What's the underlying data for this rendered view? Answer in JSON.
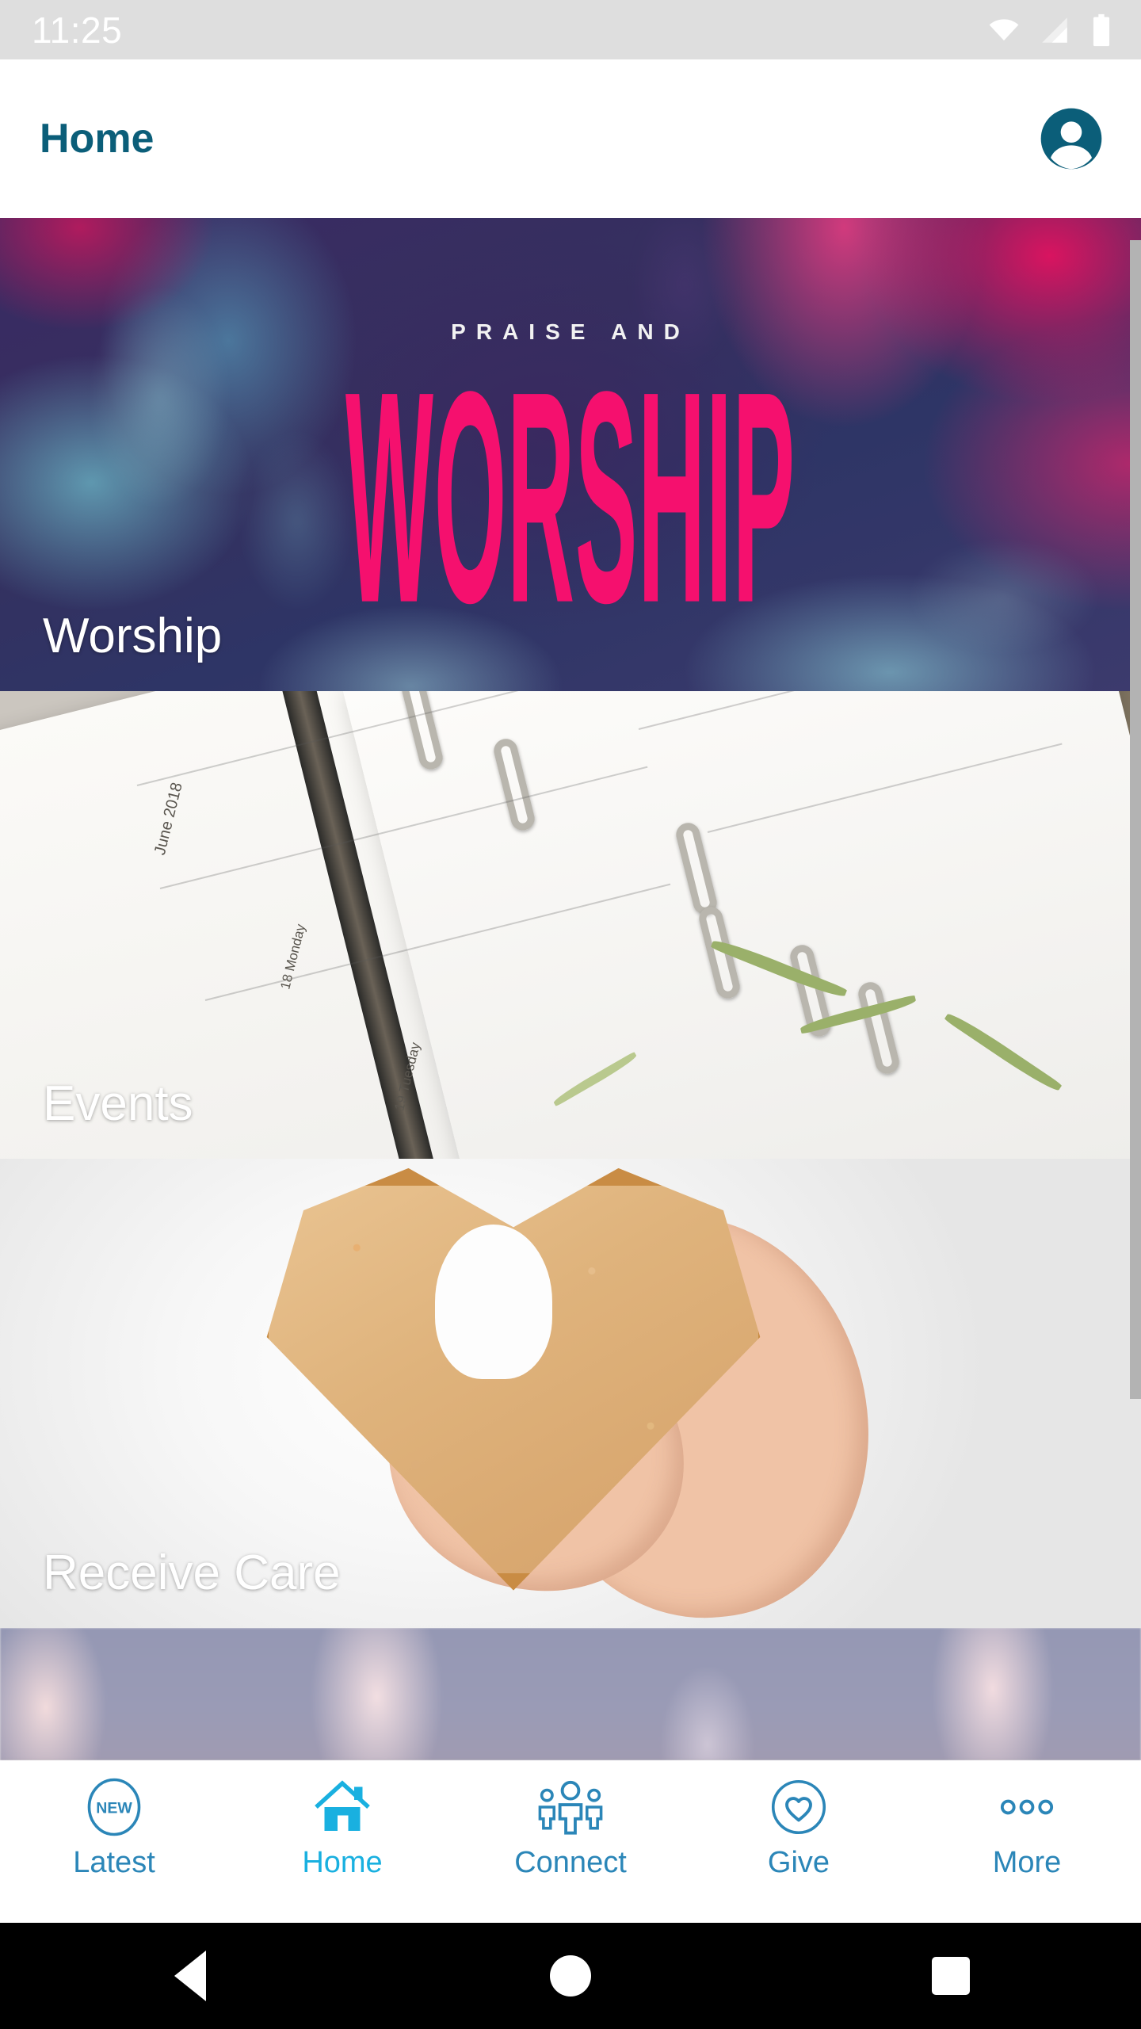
{
  "status_bar": {
    "clock": "11:25",
    "icons": [
      "wifi-icon",
      "cellular-signal-icon",
      "battery-icon"
    ],
    "background": "#dedede",
    "text_color": "#ffffff"
  },
  "app_bar": {
    "title": "Home",
    "title_color": "#0b5e79",
    "avatar_icon": "account-avatar-icon",
    "avatar_color": "#0b5e79"
  },
  "feed": {
    "cards": [
      {
        "label": "Worship",
        "artwork_overline": "PRAISE AND",
        "artwork_word": "WORSHIP",
        "artwork_word_color": "#f5106e",
        "image_description": "pink and teal smoke ink artwork"
      },
      {
        "label": "Events",
        "image_description": "open ring-bound planner with June 2018 page and plant sprigs on desk"
      },
      {
        "label": "Receive Care",
        "image_description": "hands holding a heart-shaped slice of bread"
      },
      {
        "label": "",
        "image_description": "pale lavender and pink bokeh lights"
      }
    ]
  },
  "scrollbar": {
    "visible": true,
    "color": "#b3b3b3"
  },
  "tab_bar": {
    "active_index": 1,
    "inactive_color": "#2b86b8",
    "active_color": "#19b0e0",
    "tabs": [
      {
        "label": "Latest",
        "icon": "new-badge-circle-icon"
      },
      {
        "label": "Home",
        "icon": "home-house-icon"
      },
      {
        "label": "Connect",
        "icon": "people-group-icon"
      },
      {
        "label": "Give",
        "icon": "heart-in-circle-icon"
      },
      {
        "label": "More",
        "icon": "three-dots-icon"
      }
    ]
  },
  "system_nav": {
    "buttons": [
      {
        "name": "back-button",
        "icon": "triangle-back-icon"
      },
      {
        "name": "home-button",
        "icon": "circle-home-icon"
      },
      {
        "name": "recents-button",
        "icon": "square-recents-icon"
      }
    ]
  }
}
